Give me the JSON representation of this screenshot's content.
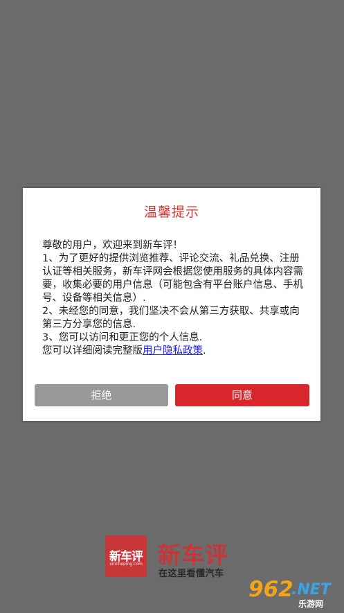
{
  "dialog": {
    "title": "温馨提示",
    "lines": [
      "尊敬的用户，欢迎来到新车评！",
      "1、为了更好的提供浏览推荐、评论交流、礼品兑换、注册认证等相关服务，新车评网会根据您使用服务的具体内容需要，收集必要的用户信息（可能包含有平台账户信息、手机号、设备等相关信息）.",
      "2、未经您的同意，我们坚决不会从第三方获取、共享或向第三方分享您的信息.",
      "3、您可以访问和更正您的个人信息."
    ],
    "last_line_prefix": "您可以详细阅读完整版",
    "policy_link": "用户隐私政策",
    "last_line_suffix": ".",
    "reject_label": "拒绝",
    "agree_label": "同意"
  },
  "brand": {
    "logo_text": "新车评",
    "logo_domain": "xincheping.com",
    "name": "新车评",
    "slogan": "在这里看懂汽车"
  },
  "watermark": {
    "number": "962",
    "suffix": ".NET",
    "site": "乐游网"
  },
  "colors": {
    "accent": "#d8262c",
    "reject": "#999999",
    "link": "#1a1aff",
    "backdrop": "#6b6b6b"
  }
}
